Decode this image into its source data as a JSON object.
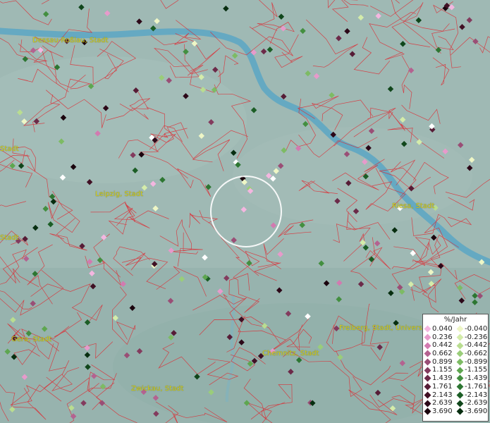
{
  "map": {
    "cities": [
      {
        "name": "Dessau-Roßlau, Stadt"
      },
      {
        "name": "Stadt"
      },
      {
        "name": "Leipzig, Stadt"
      },
      {
        "name": "Stadt"
      },
      {
        "name": "Riesa, Stadt"
      },
      {
        "name": "Freiberg, Stadt, Universi"
      },
      {
        "name": "Gera, Stadt"
      },
      {
        "name": "Chemnitz, Stadt"
      },
      {
        "name": "Zwickau, Stadt"
      }
    ],
    "colors": {
      "water": "#5aa6c4",
      "border": "#e0242c",
      "label": "#d8d21a",
      "background": "#9fb9b4"
    }
  },
  "legend": {
    "title": "%/Jahr",
    "rows": [
      {
        "pos": "0.040",
        "pos_color": "#f4b6e0",
        "neg": "-0.040",
        "neg_color": "#eef6c6"
      },
      {
        "pos": "0.236",
        "pos_color": "#e79acb",
        "neg": "-0.236",
        "neg_color": "#d4ecaa"
      },
      {
        "pos": "0.442",
        "pos_color": "#d27ab0",
        "neg": "-0.442",
        "neg_color": "#b9dd90"
      },
      {
        "pos": "0.662",
        "pos_color": "#b46290",
        "neg": "-0.662",
        "neg_color": "#9acd7a"
      },
      {
        "pos": "0.899",
        "pos_color": "#9a4e76",
        "neg": "-0.899",
        "neg_color": "#7dbb64"
      },
      {
        "pos": "1.155",
        "pos_color": "#833b5e",
        "neg": "-1.155",
        "neg_color": "#5ea650"
      },
      {
        "pos": "1.439",
        "pos_color": "#6c2a49",
        "neg": "-1.439",
        "neg_color": "#438f40"
      },
      {
        "pos": "1.761",
        "pos_color": "#561c36",
        "neg": "-1.761",
        "neg_color": "#2d7632"
      },
      {
        "pos": "2.143",
        "pos_color": "#401024",
        "neg": "-2.143",
        "neg_color": "#1c5e26"
      },
      {
        "pos": "2.639",
        "pos_color": "#2c0818",
        "neg": "-2.639",
        "neg_color": "#10461b"
      },
      {
        "pos": "3.690",
        "pos_color": "#1a030d",
        "neg": "-3.690",
        "neg_color": "#072e10"
      }
    ]
  }
}
